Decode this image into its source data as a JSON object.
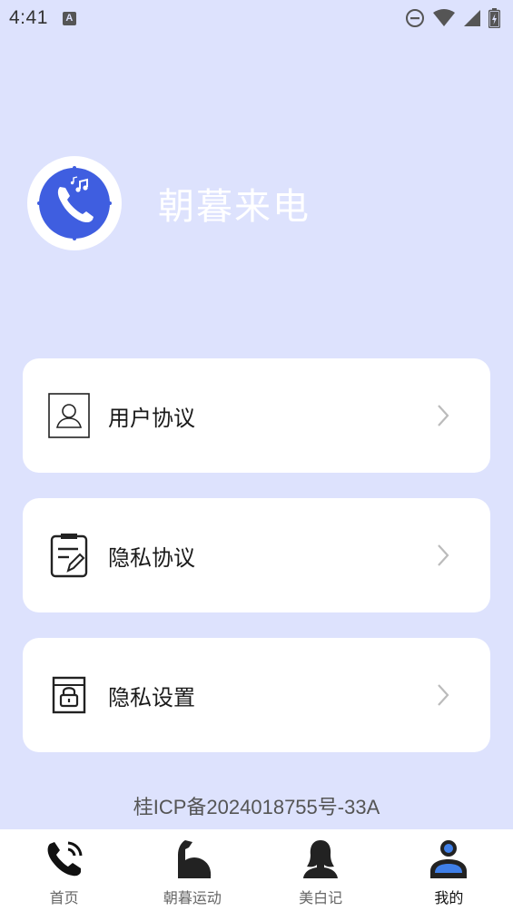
{
  "status_bar": {
    "time": "4:41",
    "notification_icon": "a-icon",
    "right_icons": [
      "dnd-icon",
      "wifi-icon",
      "signal-icon",
      "battery-icon"
    ]
  },
  "header": {
    "logo_icon": "phone-music-icon",
    "title": "朝暮来电"
  },
  "menu": {
    "items": [
      {
        "icon": "user-icon",
        "label": "用户协议"
      },
      {
        "icon": "clipboard-edit-icon",
        "label": "隐私协议"
      },
      {
        "icon": "lock-icon",
        "label": "隐私设置"
      }
    ]
  },
  "footer": {
    "icp": "桂ICP备2024018755号-33A"
  },
  "bottom_nav": {
    "items": [
      {
        "icon": "phone-icon",
        "label": "首页"
      },
      {
        "icon": "muscle-icon",
        "label": "朝暮运动"
      },
      {
        "icon": "woman-icon",
        "label": "美白记"
      },
      {
        "icon": "person-icon",
        "label": "我的"
      }
    ],
    "active_index": 3
  },
  "colors": {
    "background": "#dde2fd",
    "accent": "#3f5ee0",
    "card": "#ffffff"
  }
}
